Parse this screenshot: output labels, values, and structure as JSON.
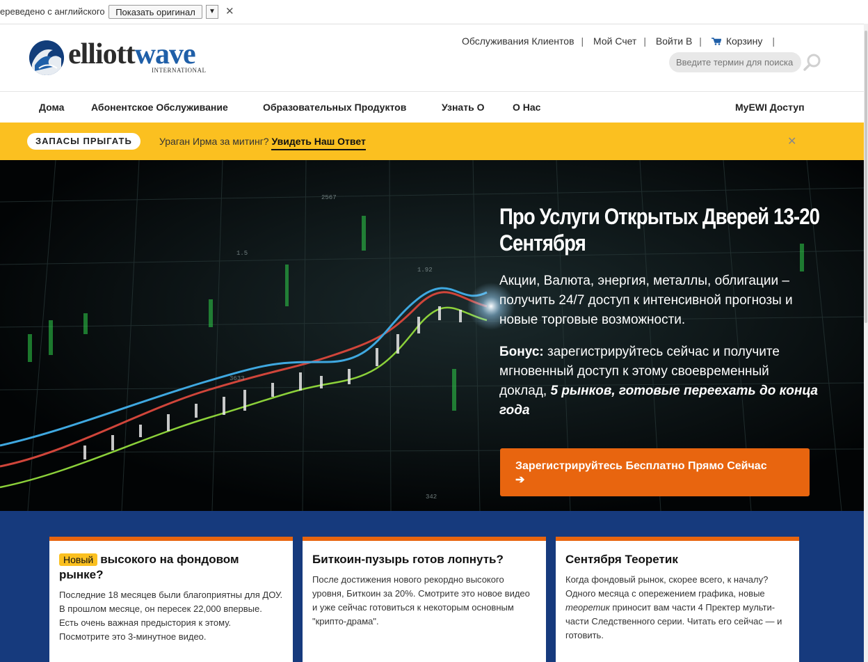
{
  "translate_bar": {
    "text": "ереведено с английского",
    "show_original": "Показать оригинал"
  },
  "logo": {
    "part1": "elliott",
    "part2": "wave",
    "sub": "INTERNATIONAL"
  },
  "toplinks": {
    "customer_service": "Обслуживания Клиентов",
    "my_account": "Мой Счет",
    "login": "Войти В",
    "cart": "Корзину"
  },
  "search": {
    "placeholder": "Введите термин для поиска"
  },
  "nav": {
    "home": "Дома",
    "subscriber": "Абонентское Обслуживание",
    "education": "Образовательных Продуктов",
    "learn": "Узнать О",
    "about": "О Нас",
    "myewi": "MyEWI Доступ"
  },
  "alert": {
    "pill": "ЗАПАСЫ ПРЫГАТЬ",
    "message": "Ураган Ирма за митинг?",
    "link": "Увидеть Наш Ответ"
  },
  "hero": {
    "title": "Про Услуги Открытых Дверей 13-20 Сентября",
    "paragraph1": "Акции, Валюта, энергия, металлы, облигации – получить 24/7 доступ к интенсивной прогнозы и новые торговые возможности.",
    "bonus_label": "Бонус:",
    "bonus_text": " зарегистрируйтесь сейчас и получите мгновенный доступ к этому своевременный доклад, ",
    "bonus_emph": "5 рынков, готовые переехать до конца года",
    "cta": "Зарегистрируйтесь Бесплатно Прямо Сейчас",
    "cta_arrow": "➔",
    "chart_labels": [
      "2567",
      "1.5",
      "1.92",
      "3633",
      "342"
    ]
  },
  "cards": [
    {
      "badge": "Новый",
      "title": "высокого на фондовом рынке?",
      "body": "Последние 18 месяцев были благоприятны для ДОУ. В прошлом месяце, он пересек 22,000 впервые. Есть очень важная предыстория к этому. Посмотрите это 3-минутное видео."
    },
    {
      "title": "Биткоин-пузырь готов лопнуть?",
      "body": "После достижения нового рекордно высокого уровня, Биткоин за 20%. Смотрите это новое видео и уже сейчас готовиться к некоторым основным \"крипто-драма\"."
    },
    {
      "title": "Сентября Теоретик",
      "body_a": "Когда фондовый рынок, скорее всего, к началу? Одного месяца с опережением графика, новые ",
      "body_em": "теоретик",
      "body_b": " приносит вам части 4 Пректер мульти-части Следственного серии. Читать его сейчас — и готовить."
    }
  ],
  "colors": {
    "alert_yellow": "#fbc020",
    "cta_orange": "#e8650f",
    "cards_bg": "#163a7d",
    "logo_blue": "#1f5fa8"
  }
}
